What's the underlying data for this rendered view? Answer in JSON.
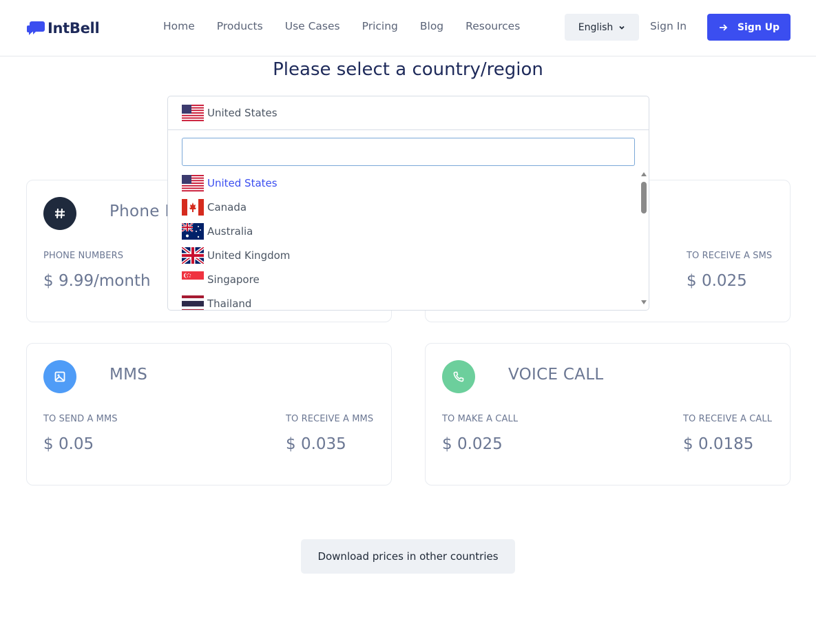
{
  "header": {
    "logo_text": "IntBell",
    "nav": [
      "Home",
      "Products",
      "Use Cases",
      "Pricing",
      "Blog",
      "Resources"
    ],
    "language": "English",
    "sign_in": "Sign In",
    "sign_up": "Sign Up"
  },
  "page_title": "Please select a country/region",
  "dropdown": {
    "selected": "United States",
    "search_value": "",
    "options": [
      "United States",
      "Canada",
      "Australia",
      "United Kingdom",
      "Singapore",
      "Thailand"
    ],
    "active_option": "United States"
  },
  "cards": {
    "phone": {
      "title": "Phone N",
      "label_left": "PHONE NUMBERS",
      "price_left": "$ 9.99/month",
      "icon": "hash-icon",
      "icon_color": "#1f2a3d"
    },
    "sms": {
      "label_right": "TO RECEIVE A SMS",
      "price_right": "$ 0.025"
    },
    "mms": {
      "title": "MMS",
      "label_left": "TO SEND A MMS",
      "price_left": "$ 0.05",
      "label_right": "TO RECEIVE A MMS",
      "price_right": "$ 0.035",
      "icon": "image-icon",
      "icon_color": "#4f9cf7"
    },
    "voice": {
      "title": "VOICE CALL",
      "label_left": "TO MAKE A CALL",
      "price_left": "$ 0.025",
      "label_right": "TO RECEIVE A CALL",
      "price_right": "$ 0.0185",
      "icon": "phone-icon",
      "icon_color": "#6ccf9c"
    }
  },
  "download_button": "Download prices in other countries",
  "colors": {
    "brand_blue": "#3b4ef0",
    "title_navy": "#1e2a5a"
  }
}
